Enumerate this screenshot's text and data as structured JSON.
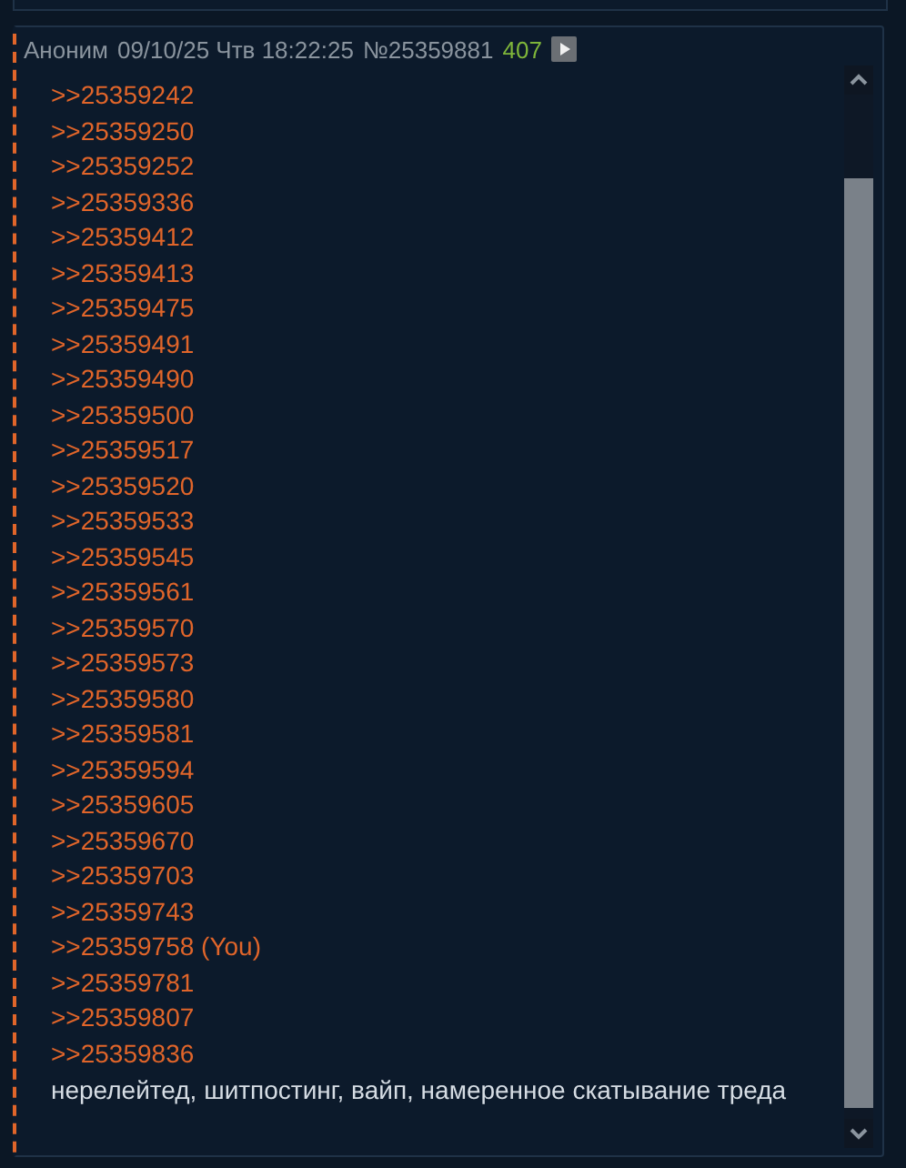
{
  "post": {
    "author": "Аноним",
    "date": "09/10/25 Чтв 18:22:25",
    "number": "№25359881",
    "reply_count": "407",
    "replies": [
      ">>25359242",
      ">>25359250",
      ">>25359252",
      ">>25359336",
      ">>25359412",
      ">>25359413",
      ">>25359475",
      ">>25359491",
      ">>25359490",
      ">>25359500",
      ">>25359517",
      ">>25359520",
      ">>25359533",
      ">>25359545",
      ">>25359561",
      ">>25359570",
      ">>25359573",
      ">>25359580",
      ">>25359581",
      ">>25359594",
      ">>25359605",
      ">>25359670",
      ">>25359703",
      ">>25359743",
      ">>25359758 (You)",
      ">>25359781",
      ">>25359807",
      ">>25359836"
    ],
    "text": "нерелейтед, шитпостинг, вайп, намеренное скатывание треда"
  }
}
